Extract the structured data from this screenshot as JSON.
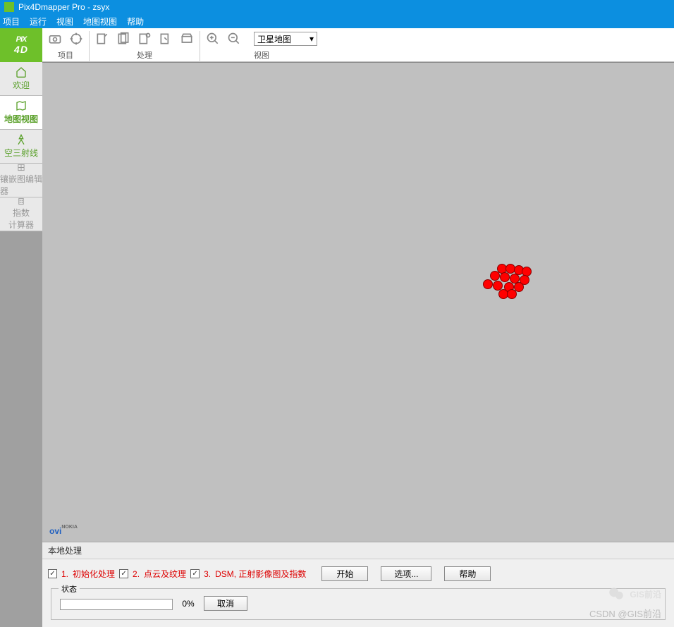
{
  "title": "Pix4Dmapper Pro - zsyx",
  "menu": [
    "项目",
    "运行",
    "视图",
    "地图视图",
    "帮助"
  ],
  "logo": {
    "top": "PIX",
    "bottom": "4D"
  },
  "nav": [
    {
      "label": "欢迎"
    },
    {
      "label": "地图视图"
    },
    {
      "label": "空三射线"
    },
    {
      "label": "镶嵌图编辑器"
    },
    {
      "label": "指数\n计算器"
    }
  ],
  "toolgroups": {
    "project": "项目",
    "process": "处理",
    "view": "视图"
  },
  "dropdown": "卫星地图",
  "ovi": {
    "main": "ovi",
    "sub": "NOKIA"
  },
  "panel": {
    "title": "本地处理"
  },
  "steps": [
    {
      "num": "1.",
      "label": "初始化处理"
    },
    {
      "num": "2.",
      "label": "点云及纹理"
    },
    {
      "num": "3.",
      "label": "DSM, 正射影像图及指数"
    }
  ],
  "buttons": {
    "start": "开始",
    "options": "选项...",
    "help": "帮助",
    "cancel": "取消"
  },
  "status": {
    "legend": "状态",
    "percent": "0%"
  },
  "watermark": {
    "text": "GIS前沿",
    "credit": "CSDN @GIS前沿"
  }
}
